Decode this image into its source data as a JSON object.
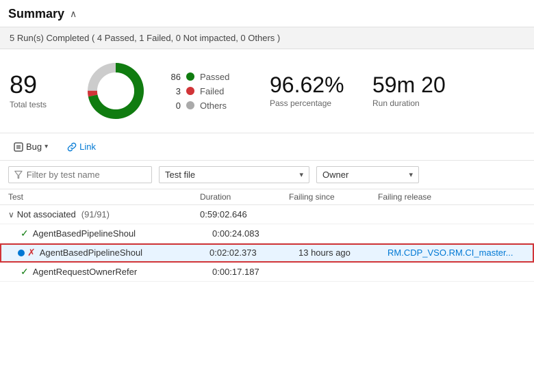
{
  "header": {
    "title": "Summary",
    "chevron": "∧"
  },
  "banner": {
    "text": "5 Run(s) Completed ( 4 Passed, 1 Failed, 0 Not impacted, 0 Others )"
  },
  "stats": {
    "total_tests": {
      "number": "89",
      "label": "Total tests"
    },
    "donut": {
      "passed": 86,
      "failed": 3,
      "others": 0,
      "total": 89
    },
    "legend": [
      {
        "count": "86",
        "label": "Passed",
        "color": "#107c10"
      },
      {
        "count": "3",
        "label": "Failed",
        "color": "#d13438"
      },
      {
        "count": "0",
        "label": "Others",
        "color": "#aaa"
      }
    ],
    "pass_pct": {
      "number": "96.62%",
      "label": "Pass percentage"
    },
    "run_duration": {
      "number": "59m 2",
      "label": "Run duration",
      "suffix": "0"
    }
  },
  "toolbar": {
    "bug_label": "Bug",
    "link_label": "Link"
  },
  "filter": {
    "placeholder": "Filter by test name",
    "test_file_label": "Test file",
    "owner_label": "Owner"
  },
  "table": {
    "columns": [
      "Test",
      "Duration",
      "Failing since",
      "Failing release"
    ],
    "group": {
      "toggle": "∨",
      "name": "Not associated",
      "count": "(91/91)",
      "duration": "0:59:02.646"
    },
    "rows": [
      {
        "status": "pass",
        "name": "AgentBasedPipelineShoul",
        "duration": "0:00:24.083",
        "failing_since": "",
        "failing_release": "",
        "selected": false,
        "has_blue_dot": false
      },
      {
        "status": "fail",
        "name": "AgentBasedPipelineShoul",
        "duration": "0:02:02.373",
        "failing_since": "13 hours ago",
        "failing_release": "RM.CDP_VSO.RM.CI_master...",
        "selected": true,
        "has_blue_dot": true
      },
      {
        "status": "pass",
        "name": "AgentRequestOwnerRefer",
        "duration": "0:00:17.187",
        "failing_since": "",
        "failing_release": "",
        "selected": false,
        "has_blue_dot": false
      }
    ]
  }
}
